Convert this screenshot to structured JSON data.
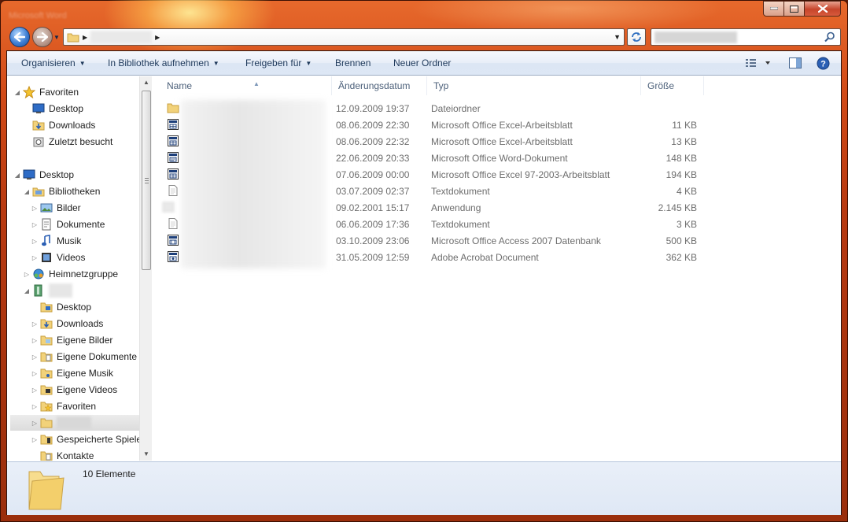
{
  "window": {
    "title": "Microsoft Word"
  },
  "search": {
    "placeholder": ""
  },
  "toolbar": {
    "organize": "Organisieren",
    "include_library": "In Bibliothek aufnehmen",
    "share": "Freigeben für",
    "burn": "Brennen",
    "new_folder": "Neuer Ordner"
  },
  "nav": {
    "favorites": "Favoriten",
    "fav_desktop": "Desktop",
    "fav_downloads": "Downloads",
    "fav_recent": "Zuletzt besucht",
    "desktop": "Desktop",
    "libraries": "Bibliotheken",
    "lib_pictures": "Bilder",
    "lib_documents": "Dokumente",
    "lib_music": "Musik",
    "lib_videos": "Videos",
    "homegroup": "Heimnetzgruppe",
    "user_desktop": "Desktop",
    "user_downloads": "Downloads",
    "user_pictures": "Eigene Bilder",
    "user_documents": "Eigene Dokumente",
    "user_music": "Eigene Musik",
    "user_videos": "Eigene Videos",
    "user_favorites": "Favoriten",
    "user_saved_games": "Gespeicherte Spiele",
    "user_contacts": "Kontakte"
  },
  "columns": {
    "name": "Name",
    "modified": "Änderungsdatum",
    "type": "Typ",
    "size": "Größe"
  },
  "files": [
    {
      "icon": "folder-icon",
      "modified": "12.09.2009 19:37",
      "type": "Dateiordner",
      "size": ""
    },
    {
      "icon": "excel-file-icon",
      "modified": "08.06.2009 22:30",
      "type": "Microsoft Office Excel-Arbeitsblatt",
      "size": "11 KB"
    },
    {
      "icon": "excel-file-icon",
      "modified": "08.06.2009 22:32",
      "type": "Microsoft Office Excel-Arbeitsblatt",
      "size": "13 KB"
    },
    {
      "icon": "word-file-icon",
      "modified": "22.06.2009 20:33",
      "type": "Microsoft Office Word-Dokument",
      "size": "148 KB"
    },
    {
      "icon": "excel-file-icon",
      "modified": "07.06.2009 00:00",
      "type": "Microsoft Office Excel 97-2003-Arbeitsblatt",
      "size": "194 KB"
    },
    {
      "icon": "text-file-icon",
      "modified": "03.07.2009 02:37",
      "type": "Textdokument",
      "size": "4 KB"
    },
    {
      "icon": "app-icon",
      "modified": "09.02.2001 15:17",
      "type": "Anwendung",
      "size": "2.145 KB"
    },
    {
      "icon": "text-file-icon",
      "modified": "06.06.2009 17:36",
      "type": "Textdokument",
      "size": "3 KB"
    },
    {
      "icon": "access-file-icon",
      "modified": "03.10.2009 23:06",
      "type": "Microsoft Office Access 2007 Datenbank",
      "size": "500 KB"
    },
    {
      "icon": "pdf-file-icon",
      "modified": "31.05.2009 12:59",
      "type": "Adobe Acrobat Document",
      "size": "362 KB"
    }
  ],
  "status": {
    "count": "10 Elemente"
  }
}
